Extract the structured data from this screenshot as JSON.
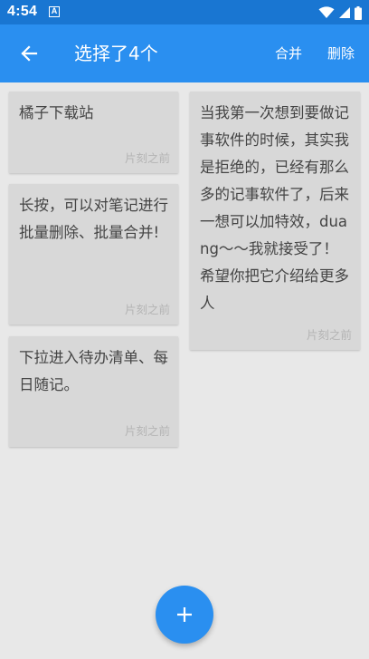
{
  "status_bar": {
    "time": "4:54",
    "notification_icon_label": "A",
    "icons": [
      "wifi-icon",
      "signal-icon",
      "battery-icon"
    ]
  },
  "app_bar": {
    "back_icon": "arrow-left-icon",
    "title": "选择了4个",
    "merge_label": "合并",
    "delete_label": "删除",
    "color": "#2a8ff0"
  },
  "notes": [
    {
      "text": "橘子下载站",
      "time": "片刻之前"
    },
    {
      "text": "长按，可以对笔记进行批量删除、批量合并!",
      "time": "片刻之前"
    },
    {
      "text": "下拉进入待办清单、每日随记。",
      "time": "片刻之前"
    },
    {
      "text": "当我第一次想到要做记事软件的时候，其实我是拒绝的，已经有那么多的记事软件了，后来一想可以加特效，duang～～我就接受了！希望你把它介绍给更多人",
      "time": "片刻之前"
    }
  ],
  "fab": {
    "icon": "plus-icon"
  }
}
